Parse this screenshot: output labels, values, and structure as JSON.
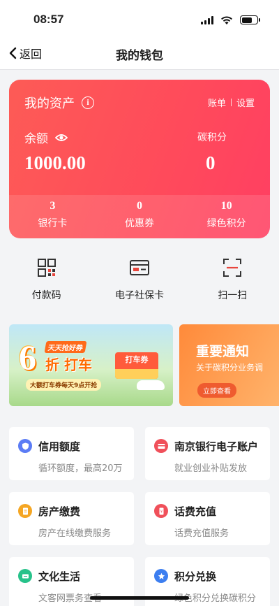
{
  "status_bar": {
    "time": "08:57"
  },
  "nav": {
    "back_label": "返回",
    "title": "我的钱包"
  },
  "asset_card": {
    "title": "我的资产",
    "links": [
      "账单",
      "设置"
    ],
    "balance_label": "余额",
    "balance_value": "1000.00",
    "carbon_label": "碳积分",
    "carbon_value": "0",
    "stats": [
      {
        "value": "3",
        "label": "银行卡"
      },
      {
        "value": "0",
        "label": "优惠券"
      },
      {
        "value": "10",
        "label": "绿色积分"
      }
    ],
    "colors": {
      "gradient_start": "#fd5b56",
      "gradient_end": "#ff3f62"
    }
  },
  "quick_actions": [
    {
      "label": "付款码",
      "icon": "payment-qr-icon"
    },
    {
      "label": "电子社保卡",
      "icon": "social-security-card-icon"
    },
    {
      "label": "扫一扫",
      "icon": "scan-icon"
    }
  ],
  "banners": {
    "taxi": {
      "big_number": "6",
      "tag": "天天抢好券",
      "headline": "折 打车",
      "subline": "大额打车券每天9点开抢",
      "coupon_label": "打车券"
    },
    "notice": {
      "title": "重要通知",
      "subtitle": "关于碳积分业务调",
      "button": "立即查看"
    }
  },
  "services": [
    {
      "title": "信用额度",
      "subtitle": "循环额度，最高20万",
      "icon": "credit-shield-icon",
      "color": "#5b7cf5"
    },
    {
      "title": "南京银行电子账户",
      "subtitle": "就业创业补贴发放",
      "icon": "bank-card-icon",
      "color": "#f0505a"
    },
    {
      "title": "房产缴费",
      "subtitle": "房产在线缴费服务",
      "icon": "property-bill-icon",
      "color": "#f5a623"
    },
    {
      "title": "话费充值",
      "subtitle": "话费充值服务",
      "icon": "phone-recharge-icon",
      "color": "#f0505a"
    },
    {
      "title": "文化生活",
      "subtitle": "文客网票务查看",
      "icon": "culture-ticket-icon",
      "color": "#27c28a"
    },
    {
      "title": "积分兑换",
      "subtitle": "绿色积分兑换碳积分",
      "icon": "star-exchange-icon",
      "color": "#3c7ef0"
    }
  ]
}
